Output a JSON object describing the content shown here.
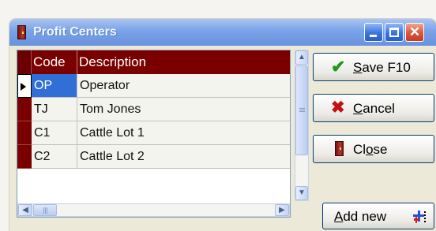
{
  "window": {
    "title": "Profit Centers"
  },
  "grid": {
    "columns": [
      "Code",
      "Description"
    ],
    "rows": [
      {
        "code": "OP",
        "description": "Operator",
        "selected": true
      },
      {
        "code": "TJ",
        "description": "Tom Jones",
        "selected": false
      },
      {
        "code": "C1",
        "description": "Cattle Lot 1",
        "selected": false
      },
      {
        "code": "C2",
        "description": "Cattle Lot 2",
        "selected": false
      }
    ]
  },
  "buttons": {
    "save": {
      "prefix": "",
      "accel": "S",
      "rest": "ave F10",
      "icon": "checkmark-icon"
    },
    "cancel": {
      "prefix": "",
      "accel": "C",
      "rest": "ancel",
      "icon": "red-x-icon"
    },
    "close": {
      "prefix": "Cl",
      "accel": "o",
      "rest": "se",
      "icon": "door-icon"
    },
    "add_new": {
      "prefix": "",
      "accel": "A",
      "rest": "dd new",
      "icon": "add-record-icon"
    }
  },
  "colors": {
    "header_bg": "#7a0000",
    "selection": "#2f6fd6",
    "titlebar": "#7aa2e8"
  }
}
